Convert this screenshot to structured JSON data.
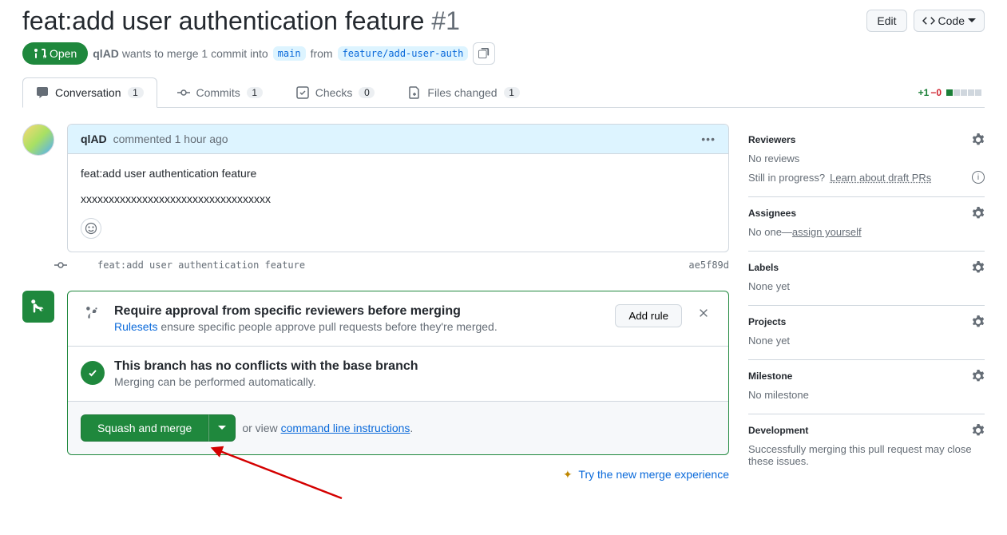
{
  "header": {
    "title": "feat:add user authentication feature",
    "number": "#1",
    "edit": "Edit",
    "code": "Code"
  },
  "meta": {
    "state": "Open",
    "author": "qlAD",
    "wants": "wants to merge 1 commit into",
    "base": "main",
    "from": "from",
    "head": "feature/add-user-auth"
  },
  "tabs": {
    "conversation": "Conversation",
    "conversationCount": "1",
    "commits": "Commits",
    "commitsCount": "1",
    "checks": "Checks",
    "checksCount": "0",
    "files": "Files changed",
    "filesCount": "1"
  },
  "diff": {
    "add": "+1",
    "del": "−0"
  },
  "comment": {
    "author": "qlAD",
    "verb": "commented",
    "time": "1 hour ago",
    "body1": "feat:add user authentication feature",
    "body2": "xxxxxxxxxxxxxxxxxxxxxxxxxxxxxxxxxx"
  },
  "commit": {
    "msg": "feat:add user authentication feature",
    "sha": "ae5f89d"
  },
  "rule": {
    "title": "Require approval from specific reviewers before merging",
    "link": "Rulesets",
    "rest": " ensure specific people approve pull requests before they're merged.",
    "btn": "Add rule"
  },
  "conflict": {
    "title": "This branch has no conflicts with the base branch",
    "sub": "Merging can be performed automatically."
  },
  "merge": {
    "btn": "Squash and merge",
    "or": "or view",
    "link": "command line instructions",
    "tryNew": "Try the new merge experience"
  },
  "sidebar": {
    "reviewers": {
      "title": "Reviewers",
      "none": "No reviews",
      "draft1": "Still in progress?",
      "draft2": "Learn about draft PRs"
    },
    "assignees": {
      "title": "Assignees",
      "none": "No one—",
      "link": "assign yourself"
    },
    "labels": {
      "title": "Labels",
      "none": "None yet"
    },
    "projects": {
      "title": "Projects",
      "none": "None yet"
    },
    "milestone": {
      "title": "Milestone",
      "none": "No milestone"
    },
    "development": {
      "title": "Development",
      "body": "Successfully merging this pull request may close these issues."
    }
  }
}
